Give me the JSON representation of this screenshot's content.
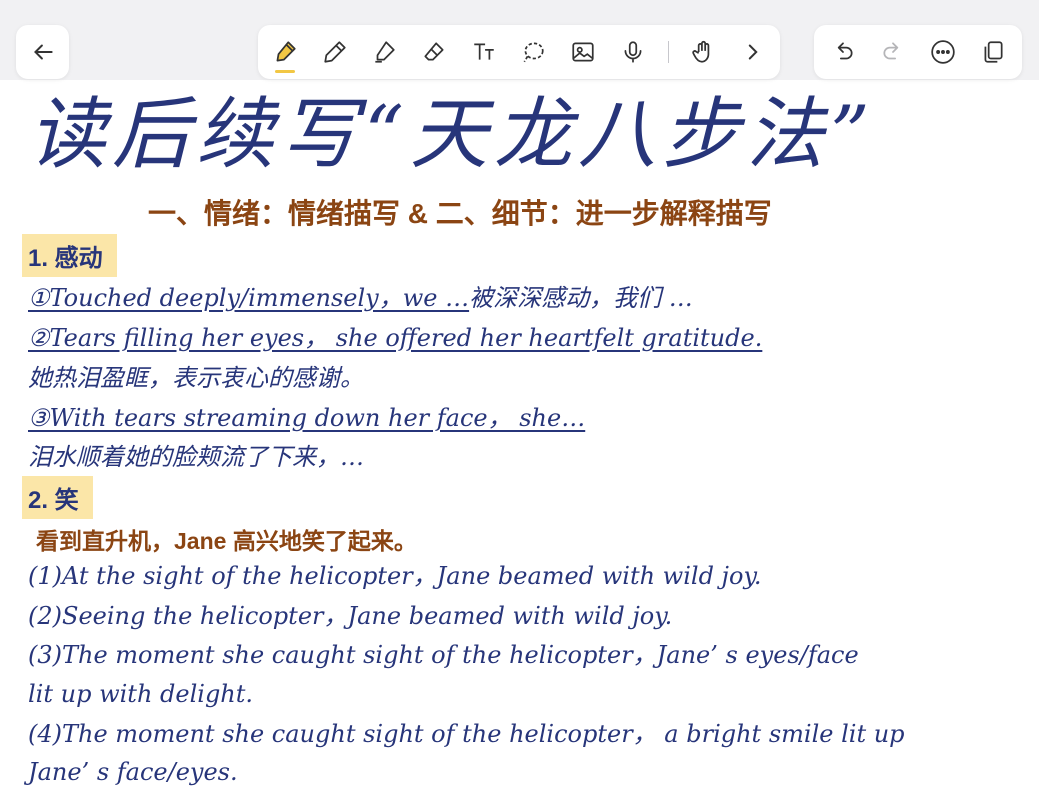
{
  "toolbar": {
    "icons": [
      "back-arrow-icon",
      "highlighter-icon",
      "pen-icon",
      "marker-icon",
      "eraser-icon",
      "text-icon",
      "lasso-icon",
      "image-icon",
      "microphone-icon",
      "hand-icon",
      "chevron-right-icon",
      "undo-icon",
      "redo-icon",
      "more-icon",
      "pages-icon"
    ],
    "accent": "#f2c744"
  },
  "note": {
    "title": "读后续写“天龙八步法”",
    "subtitle": "一、情绪：情绪描写 & 二、细节：进一步解释描写",
    "section1": {
      "label": "1. 感动",
      "line1_en": "①Touched deeply/immensely，we …",
      "line1_cn": "被深深感动，我们 …",
      "line2_en": "②Tears filling her eyes， she offered her heartfelt gratitude.",
      "line2_cn": "她热泪盈眶，表示衷心的感谢。",
      "line3_en": "③With tears streaming down her face， she…",
      "line3_cn": "泪水顺着她的脸颊流了下来，…"
    },
    "section2": {
      "label": "2. 笑",
      "example_cn": "看到直升机，Jane 高兴地笑了起来。",
      "line1": "(1)At the sight of the helicopter，Jane beamed with wild joy.",
      "line2": "(2)Seeing the helicopter，Jane beamed with wild joy.",
      "line3a": "(3)The moment she caught sight of the helicopter，Jane’ s eyes/face",
      "line3b": "lit up with delight.",
      "line4a": "(4)The moment she caught sight of the helicopter， a bright smile lit up",
      "line4b": "Jane’ s face/eyes."
    },
    "colors": {
      "ink": "#27357a",
      "heading": "#8b4513",
      "highlight": "#fbe6a8"
    }
  }
}
